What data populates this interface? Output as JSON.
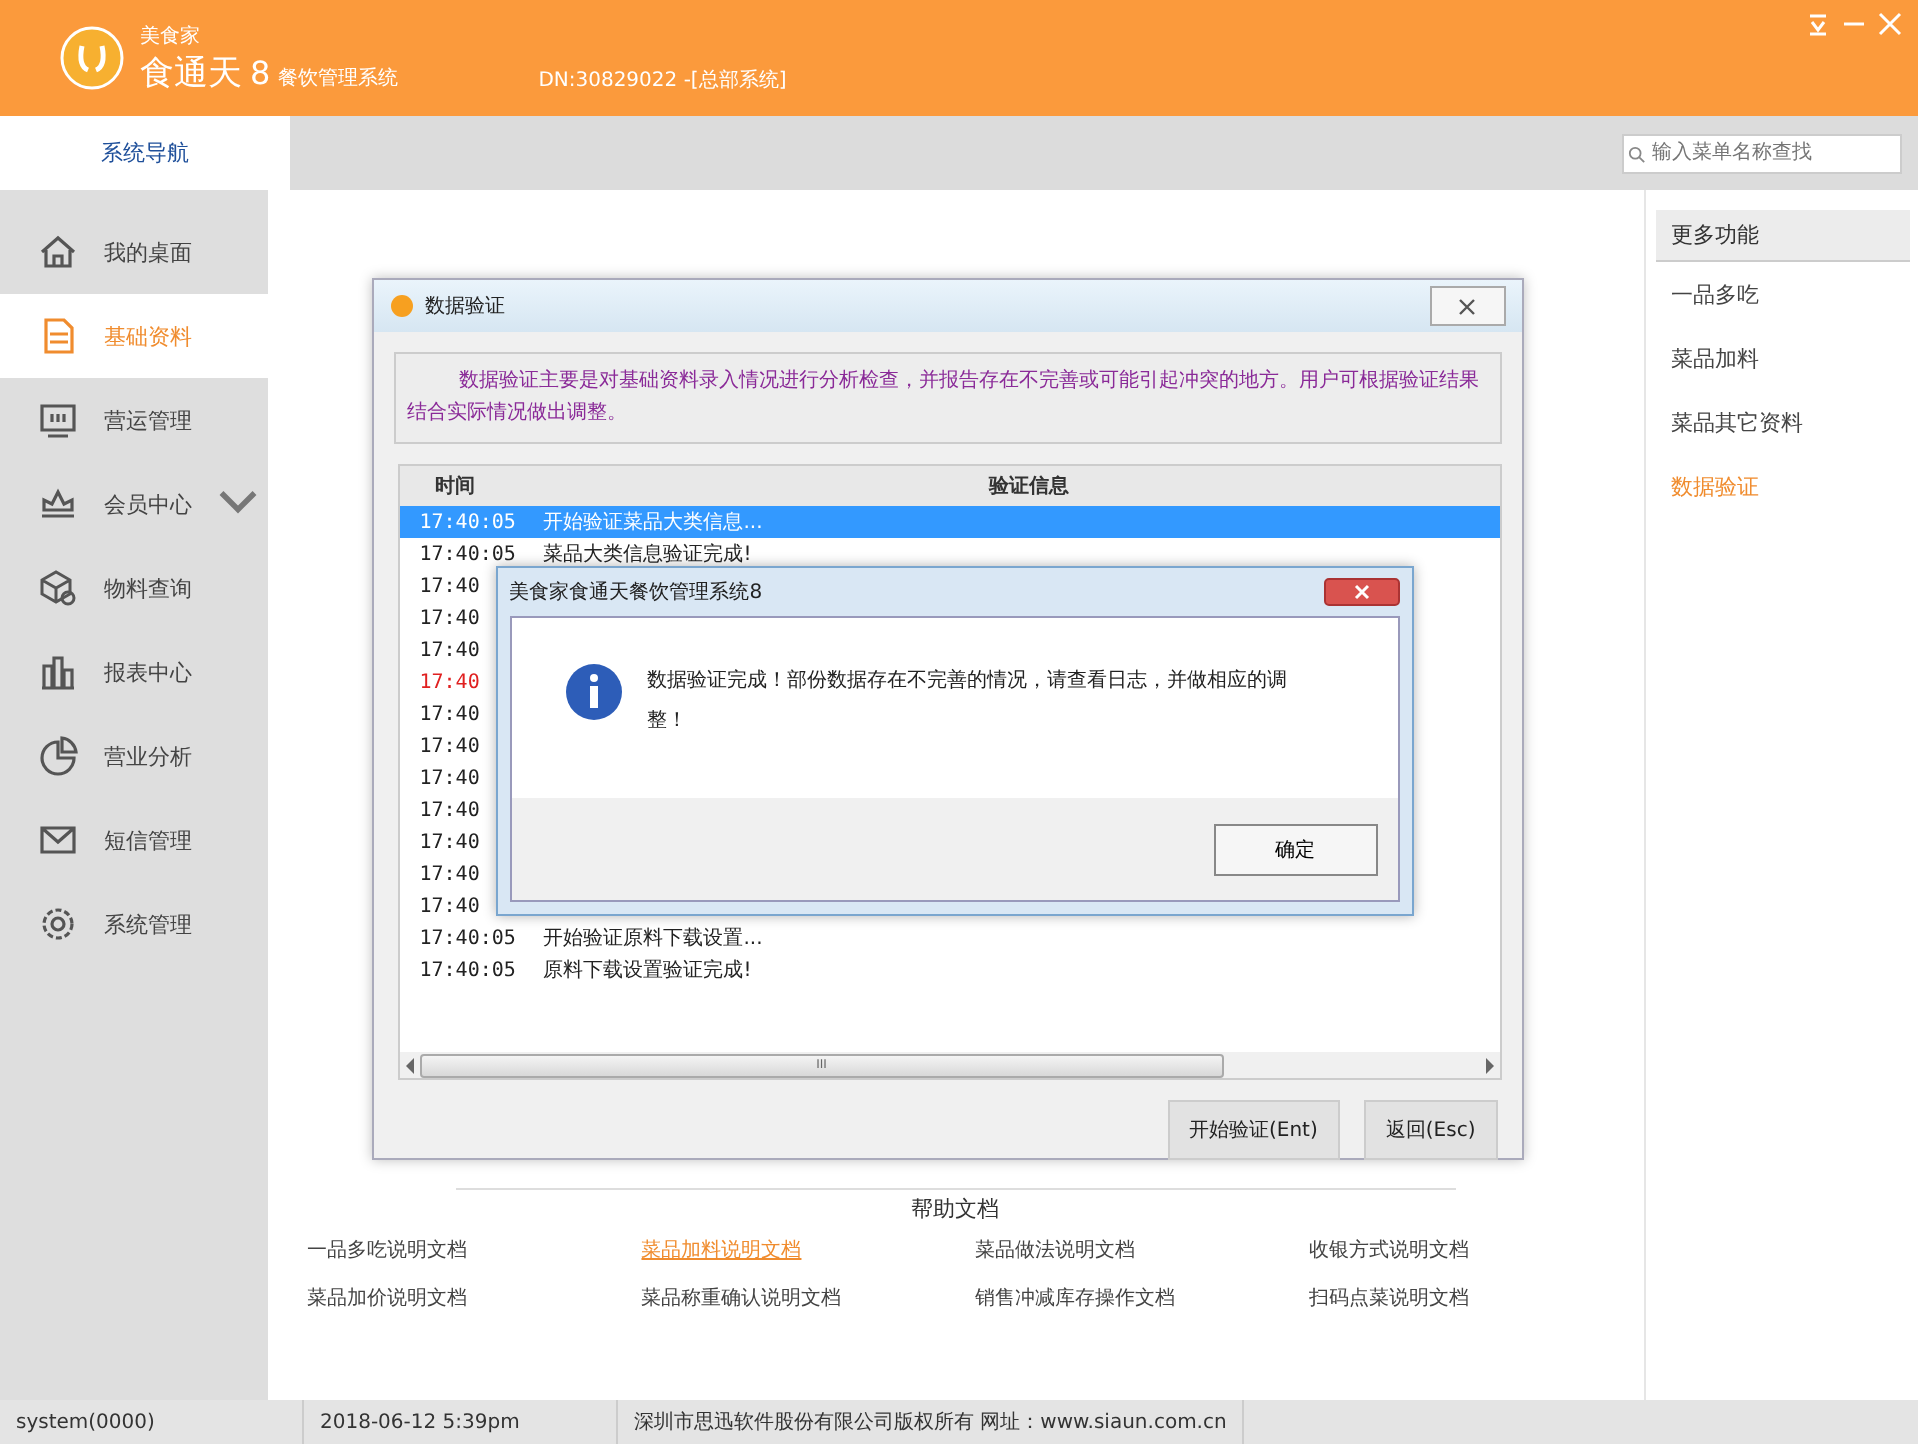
{
  "window": {
    "brand_small": "美食家",
    "brand": "食通天",
    "version": "8",
    "subtitle": "餐饮管理系统",
    "dn": "DN:30829022 -[总部系统]"
  },
  "nav_tab": {
    "label": "系统导航",
    "selected": true
  },
  "search": {
    "placeholder": "输入菜单名称查找"
  },
  "sidebar": {
    "items": [
      {
        "label": "我的桌面",
        "selected": false,
        "expandable": false
      },
      {
        "label": "基础资料",
        "selected": true,
        "expandable": false
      },
      {
        "label": "营运管理",
        "selected": false,
        "expandable": false
      },
      {
        "label": "会员中心",
        "selected": false,
        "expandable": true
      },
      {
        "label": "物料查询",
        "selected": false,
        "expandable": false
      },
      {
        "label": "报表中心",
        "selected": false,
        "expandable": false
      },
      {
        "label": "营业分析",
        "selected": false,
        "expandable": false
      },
      {
        "label": "短信管理",
        "selected": false,
        "expandable": false
      },
      {
        "label": "系统管理",
        "selected": false,
        "expandable": false
      }
    ]
  },
  "more_panel": {
    "title": "更多功能",
    "items": [
      {
        "label": "一品多吃",
        "selected": false
      },
      {
        "label": "菜品加料",
        "selected": false
      },
      {
        "label": "菜品其它资料",
        "selected": false
      },
      {
        "label": "数据验证",
        "selected": true
      }
    ]
  },
  "dialog": {
    "title": "数据验证",
    "description": "数据验证主要是对基础资料录入情况进行分析检查，并报告存在不完善或可能引起冲突的地方。用户可根据验证结果结合实际情况做出调整。",
    "columns": [
      "时间",
      "验证信息"
    ],
    "rows": [
      {
        "time": "17:40:05",
        "message": "开始验证菜品大类信息...",
        "selected": true,
        "error": false
      },
      {
        "time": "17:40:05",
        "message": "菜品大类信息验证完成!",
        "selected": false,
        "error": false
      },
      {
        "time": "17:40",
        "selected": false,
        "error": false
      },
      {
        "time": "17:40",
        "selected": false,
        "error": false
      },
      {
        "time": "17:40",
        "selected": false,
        "error": false
      },
      {
        "time": "17:40",
        "selected": false,
        "error": true
      },
      {
        "time": "17:40",
        "selected": false,
        "error": false
      },
      {
        "time": "17:40",
        "selected": false,
        "error": false
      },
      {
        "time": "17:40",
        "selected": false,
        "error": false
      },
      {
        "time": "17:40",
        "selected": false,
        "error": false
      },
      {
        "time": "17:40",
        "selected": false,
        "error": false
      },
      {
        "time": "17:40",
        "selected": false,
        "error": false
      },
      {
        "time": "17:40",
        "selected": false,
        "error": false
      },
      {
        "time": "17:40:05",
        "message": "开始验证原料下载设置...",
        "selected": false,
        "error": false
      },
      {
        "time": "17:40:05",
        "message": "原料下载设置验证完成!",
        "selected": false,
        "error": false
      }
    ],
    "scrollbar_label": "III",
    "buttons": [
      "开始验证(Ent)",
      "返回(Esc)"
    ]
  },
  "message_box": {
    "title": "美食家食通天餐饮管理系统8",
    "text": "数据验证完成！部份数据存在不完善的情况，请查看日志，并做相应的调整！",
    "button": "确定"
  },
  "help": {
    "title": "帮助文档",
    "links": [
      {
        "label": "一品多吃说明文档",
        "selected": false
      },
      {
        "label": "菜品加料说明文档",
        "selected": true
      },
      {
        "label": "菜品做法说明文档",
        "selected": false
      },
      {
        "label": "收银方式说明文档",
        "selected": false
      },
      {
        "label": "菜品加价说明文档",
        "selected": false
      },
      {
        "label": "菜品称重确认说明文档",
        "selected": false
      },
      {
        "label": "销售冲减库存操作文档",
        "selected": false
      },
      {
        "label": "扫码点菜说明文档",
        "selected": false
      }
    ]
  },
  "status_bar": [
    "system(0000)",
    "2018-06-12 5:39pm",
    "深圳市思迅软件股份有限公司版权所有 网址：www.siaun.com.cn"
  ]
}
